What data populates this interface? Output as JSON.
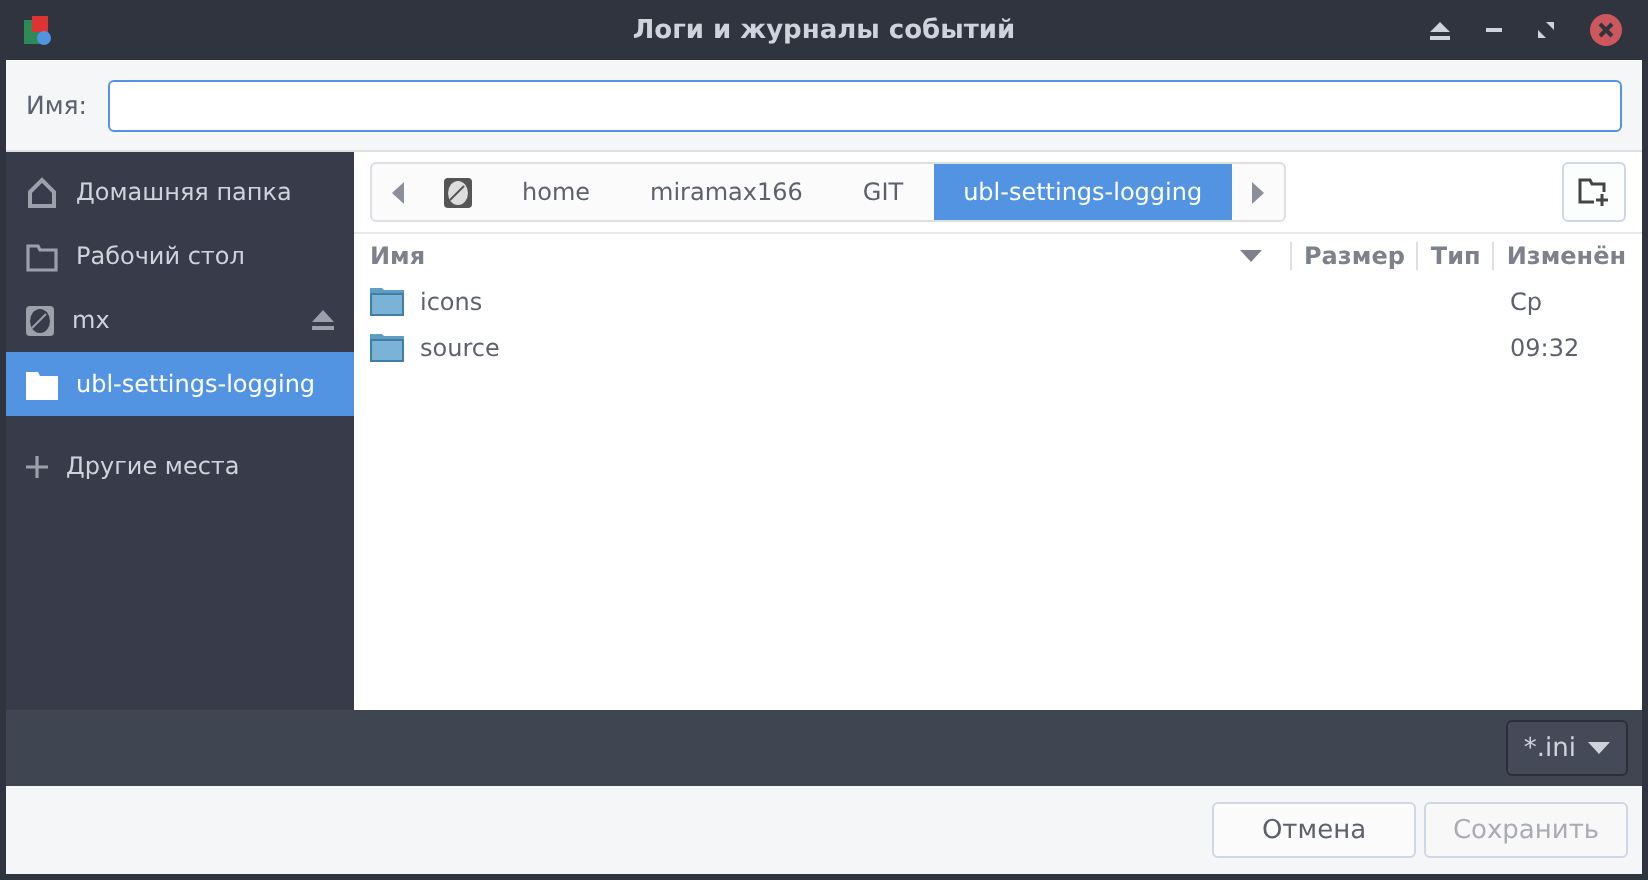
{
  "window": {
    "title": "Логи и журналы событий"
  },
  "name_field": {
    "label": "Имя:"
  },
  "sidebar": {
    "items": [
      {
        "kind": "home",
        "label": "Домашняя папка",
        "selected": false,
        "eject": false
      },
      {
        "kind": "folder",
        "label": "Рабочий стол",
        "selected": false,
        "eject": false
      },
      {
        "kind": "disk",
        "label": "mx",
        "selected": false,
        "eject": true
      },
      {
        "kind": "folder",
        "label": "ubl-settings-logging",
        "selected": true,
        "eject": false
      },
      {
        "kind": "add",
        "label": "Другие места",
        "selected": false,
        "eject": false
      }
    ]
  },
  "path_bar": {
    "items": [
      {
        "kind": "disk",
        "selected": false
      },
      {
        "kind": "text",
        "label": "home",
        "selected": false
      },
      {
        "kind": "text",
        "label": "miramax166",
        "selected": false
      },
      {
        "kind": "text",
        "label": "GIT",
        "selected": false
      },
      {
        "kind": "text",
        "label": "ubl-settings-logging",
        "selected": true
      }
    ]
  },
  "table": {
    "columns": [
      "Имя",
      "Размер",
      "Тип",
      "Изменён"
    ],
    "rows": [
      {
        "name": "icons",
        "modified": "Ср"
      },
      {
        "name": "source",
        "modified": "09:32"
      }
    ]
  },
  "filter": {
    "value": "*.ini"
  },
  "buttons": [
    {
      "label": "Отмена",
      "disabled": false
    },
    {
      "label": "Сохранить",
      "disabled": true
    }
  ]
}
